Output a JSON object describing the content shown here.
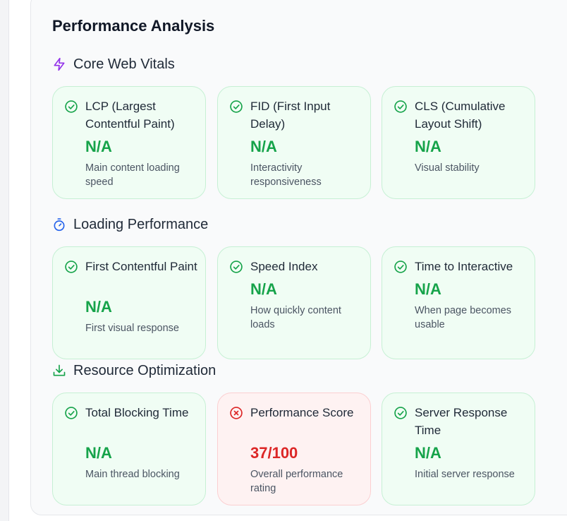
{
  "panel": {
    "title": "Performance Analysis"
  },
  "sections": [
    {
      "title": "Core Web Vitals",
      "icon": "lightning-bolt-icon",
      "cards": [
        {
          "label": "LCP (Largest Contentful Paint)",
          "value": "N/A",
          "description": "Main content loading speed",
          "status": "pass"
        },
        {
          "label": "FID (First Input Delay)",
          "value": "N/A",
          "description": "Interactivity responsiveness",
          "status": "pass"
        },
        {
          "label": "CLS (Cumulative Layout Shift)",
          "value": "N/A",
          "description": "Visual stability",
          "status": "pass"
        }
      ]
    },
    {
      "title": "Loading Performance",
      "icon": "timer-icon",
      "cards": [
        {
          "label": "First Contentful Paint",
          "value": "N/A",
          "description": "First visual response",
          "status": "pass"
        },
        {
          "label": "Speed Index",
          "value": "N/A",
          "description": "How quickly content loads",
          "status": "pass"
        },
        {
          "label": "Time to Interactive",
          "value": "N/A",
          "description": "When page becomes usable",
          "status": "pass"
        }
      ]
    },
    {
      "title": "Resource Optimization",
      "icon": "download-icon",
      "cards": [
        {
          "label": "Total Blocking Time",
          "value": "N/A",
          "description": "Main thread blocking",
          "status": "pass"
        },
        {
          "label": "Performance Score",
          "value": "37/100",
          "description": "Overall performance rating",
          "status": "fail"
        },
        {
          "label": "Server Response Time",
          "value": "N/A",
          "description": "Initial server response",
          "status": "pass"
        }
      ]
    }
  ],
  "colors": {
    "pass": "#16a34a",
    "fail": "#dc2626",
    "vitals_icon": "#9333ea",
    "loading_icon": "#2563eb",
    "resource_icon": "#16a34a"
  }
}
